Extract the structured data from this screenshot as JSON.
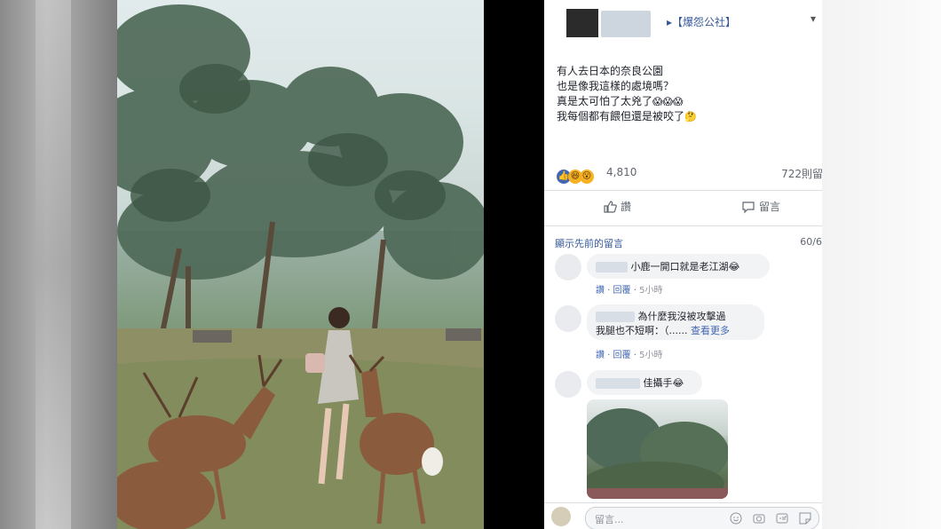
{
  "post": {
    "group_link": "▸【爆怨公社】",
    "more": "▾",
    "lines": [
      "有人去日本的奈良公園",
      "也是像我這樣的處境嗎？",
      "真是太可怕了太兇了",
      "我每個都有餵但還是被咬了"
    ],
    "line3_emoji": "😱😱😱",
    "line4_emoji": "🤔",
    "reactions": {
      "count": "4,810",
      "comments": "722則留",
      "icons": [
        "like-icon",
        "haha-icon",
        "wow-icon"
      ]
    },
    "actions": {
      "like": "讚",
      "comment": "留言"
    }
  },
  "comments": {
    "header": "顯示先前的留言",
    "pager": "60/6",
    "items": [
      {
        "text": "小鹿一開口就是老江湖",
        "emoji": "😂",
        "meta_actions": "讚 · 回覆 ·",
        "time": "5小時"
      },
      {
        "text1": "為什麼我沒被攻擊過",
        "text2": "我腿也不短啊：（......",
        "see_more": "查看更多",
        "meta_actions": "讚 · 回覆 ·",
        "time": "5小時"
      },
      {
        "text": "佳攝手",
        "emoji": "😂"
      }
    ],
    "write_placeholder": "留言...",
    "write_icons": [
      "emoji-icon",
      "camera-icon",
      "gif-icon",
      "sticker-icon"
    ]
  },
  "colors": {
    "link": "#365899",
    "like_blue": "#4267b2",
    "bubble": "#f2f3f5"
  }
}
